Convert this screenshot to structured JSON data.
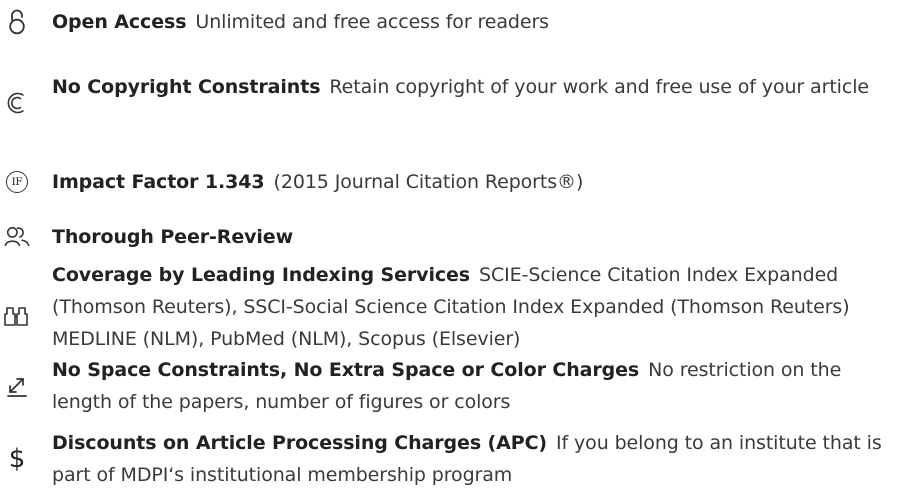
{
  "features": [
    {
      "icon": "open-lock-icon",
      "title": "Open Access",
      "desc": "Unlimited and free access for readers"
    },
    {
      "icon": "copyright-icon",
      "title": "No Copyright Constraints",
      "desc": "Retain copyright of your work and free use of your article"
    },
    {
      "icon": "impact-factor-icon",
      "icon_text": "IF",
      "title": "Impact Factor 1.343",
      "desc": "(2015 Journal Citation Reports®)"
    },
    {
      "icon": "peer-review-icon",
      "title": "Thorough Peer-Review",
      "desc": ""
    },
    {
      "icon": "indexing-icon",
      "title": "Coverage by Leading Indexing Services",
      "desc": "SCIE-Science Citation Index Expanded (Thomson Reuters), SSCI-Social Science Citation Index Expanded (Thomson Reuters) MEDLINE (NLM), PubMed (NLM), Scopus (Elsevier)"
    },
    {
      "icon": "expand-icon",
      "title": "No Space Constraints, No Extra Space or Color Charges",
      "desc": "No restriction on the length of the papers, number of figures or colors"
    },
    {
      "icon": "dollar-icon",
      "icon_text": "$",
      "title": "Discounts on Article Processing Charges (APC)",
      "desc": "If you belong to an institute that is part of MDPI‘s institutional membership program"
    }
  ]
}
